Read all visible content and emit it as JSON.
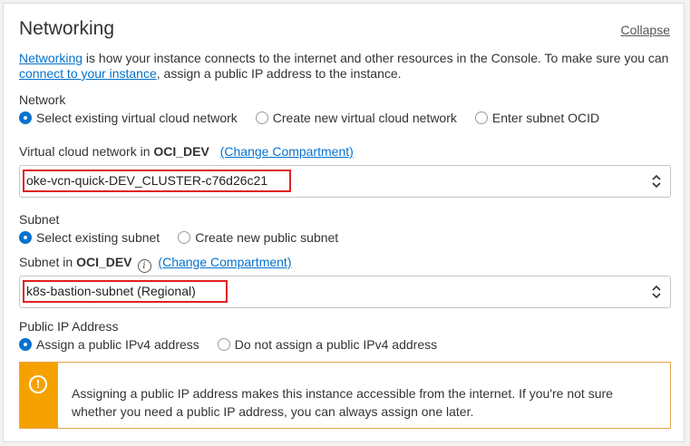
{
  "section": {
    "title": "Networking",
    "collapse_label": "Collapse"
  },
  "description": {
    "link1": "Networking",
    "text1": " is how your instance connects to the internet and other resources in the Console. To make sure you can ",
    "link2": "connect to your instance",
    "text2": ", assign a public IP address to the instance."
  },
  "network": {
    "label": "Network",
    "options": [
      "Select existing virtual cloud network",
      "Create new virtual cloud network",
      "Enter subnet OCID"
    ],
    "selected_index": 0
  },
  "vcn": {
    "label_prefix": "Virtual cloud network in ",
    "compartment": "OCI_DEV",
    "change_compartment": "(Change Compartment)",
    "value": "oke-vcn-quick-DEV_CLUSTER-c76d26c21"
  },
  "subnet": {
    "label": "Subnet",
    "options": [
      "Select existing subnet",
      "Create new public subnet"
    ],
    "selected_index": 0,
    "in_label_prefix": "Subnet in ",
    "compartment": "OCI_DEV",
    "info_icon": "i",
    "change_compartment": "(Change Compartment)",
    "value": "k8s-bastion-subnet (Regional)"
  },
  "public_ip": {
    "label": "Public IP Address",
    "options": [
      "Assign a public IPv4 address",
      "Do not assign a public IPv4 address"
    ],
    "selected_index": 0
  },
  "alert": {
    "icon": "warning-icon",
    "glyph": "!",
    "message": "Assigning a public IP address makes this instance accessible from the internet. If you're not sure whether you need a public IP address, you can always assign one later."
  },
  "colors": {
    "link": "#0572ce",
    "highlight": "#e02020",
    "warning": "#f5a200"
  }
}
